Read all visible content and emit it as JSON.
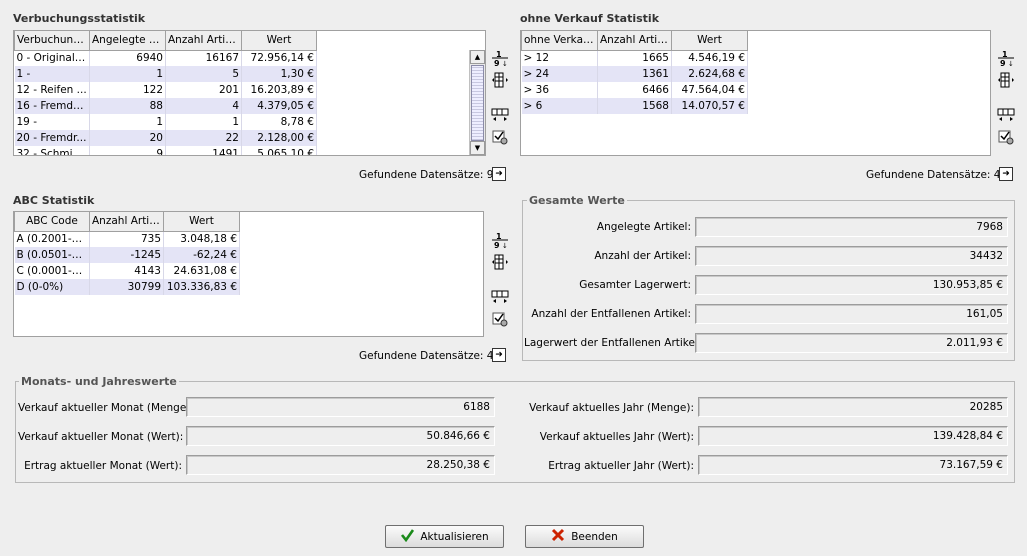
{
  "verbuchung": {
    "title": "Verbuchungsstatistik",
    "columns": [
      "Verbuchung...",
      "Angelegte Ar...",
      "Anzahl Artikel",
      "Wert"
    ],
    "rows": [
      [
        "0 - Originalte...",
        "6940",
        "16167",
        "72.956,14 €"
      ],
      [
        "1 -",
        "1",
        "5",
        "1,30 €"
      ],
      [
        "12 - Reifen ...",
        "122",
        "201",
        "16.203,89 €"
      ],
      [
        "16 - Fremdte...",
        "88",
        "4",
        "4.379,05 €"
      ],
      [
        "19 -",
        "1",
        "1",
        "8,78 €"
      ],
      [
        "20 - Fremdr...",
        "20",
        "22",
        "2.128,00 €"
      ],
      [
        "32 - Schmier...",
        "9",
        "1491",
        "5.065,10 €"
      ]
    ],
    "found_label": "Gefundene Datensätze: 9"
  },
  "ohne": {
    "title": "ohne Verkauf Statistik",
    "columns": [
      "ohne Verkau...",
      "Anzahl Artikel",
      "Wert"
    ],
    "rows": [
      [
        "> 12",
        "1665",
        "4.546,19 €"
      ],
      [
        "> 24",
        "1361",
        "2.624,68 €"
      ],
      [
        "> 36",
        "6466",
        "47.564,04 €"
      ],
      [
        "> 6",
        "1568",
        "14.070,57 €"
      ]
    ],
    "found_label": "Gefundene Datensätze: 4"
  },
  "abc": {
    "title": "ABC Statistik",
    "columns": [
      "ABC Code",
      "Anzahl Artikel",
      "Wert"
    ],
    "rows": [
      [
        "A (0.2001-1...",
        "735",
        "3.048,18 €"
      ],
      [
        "B (0.0501-0....",
        "-1245",
        "-62,24 €"
      ],
      [
        "C (0.0001-0....",
        "4143",
        "24.631,08 €"
      ],
      [
        "D (0-0%)",
        "30799",
        "103.336,83 €"
      ]
    ],
    "found_label": "Gefundene Datensätze: 4"
  },
  "gesamt": {
    "title": "Gesamte Werte",
    "items": [
      {
        "label": "Angelegte Artikel:",
        "value": "7968"
      },
      {
        "label": "Anzahl der Artikel:",
        "value": "34432"
      },
      {
        "label": "Gesamter Lagerwert:",
        "value": "130.953,85 €"
      },
      {
        "label": "Anzahl der Entfallenen Artikel:",
        "value": "161,05"
      },
      {
        "label": "Lagerwert der Entfallenen Artikel:",
        "value": "2.011,93 €"
      }
    ]
  },
  "monats": {
    "title": "Monats- und Jahreswerte",
    "left": [
      {
        "label": "Verkauf aktueller Monat (Menge):",
        "value": "6188"
      },
      {
        "label": "Verkauf aktueller Monat (Wert):",
        "value": "50.846,66 €"
      },
      {
        "label": "Ertrag aktueller Monat (Wert):",
        "value": "28.250,38 €"
      }
    ],
    "right": [
      {
        "label": "Verkauf aktuelles Jahr (Menge):",
        "value": "20285"
      },
      {
        "label": "Verkauf aktuelles Jahr (Wert):",
        "value": "139.428,84 €"
      },
      {
        "label": "Ertrag aktueller Jahr (Wert):",
        "value": "73.167,59 €"
      }
    ]
  },
  "buttons": {
    "refresh": "Aktualisieren",
    "exit": "Beenden"
  },
  "colors": {
    "row_alt": "#e4e4f6",
    "check": "#1a8a1a",
    "cross": "#cc2200"
  }
}
